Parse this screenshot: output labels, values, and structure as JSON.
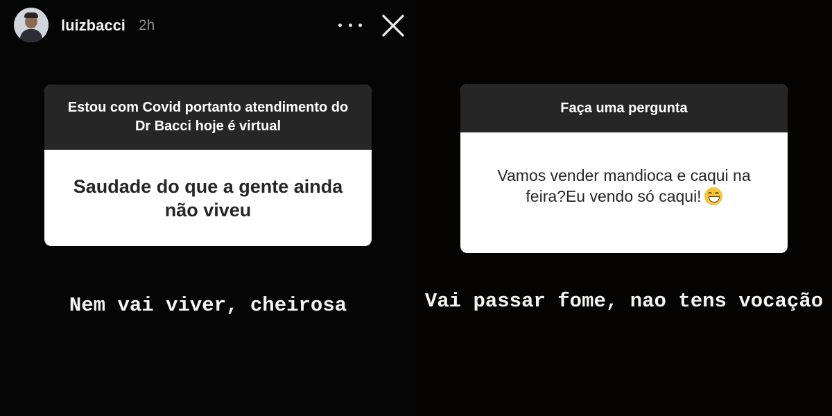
{
  "header": {
    "username": "luizbacci",
    "timestamp": "2h",
    "more_icon": "more-horizontal-icon",
    "close_icon": "close-icon"
  },
  "stories": [
    {
      "question_header": "Estou com Covid portanto atendimento do Dr Bacci hoje é virtual",
      "question": "Saudade do que a gente ainda não viveu",
      "reply": "Nem vai viver, cheirosa"
    },
    {
      "question_header": "Faça uma pergunta",
      "question": "Vamos vender mandioca e caqui na feira?Eu vendo só caqui!",
      "emoji": "grinning-face-icon",
      "reply": "Vai passar fome, nao tens vocação"
    }
  ],
  "colors": {
    "card_header_bg": "#262626",
    "card_body_bg": "#ffffff",
    "background": "#000000"
  }
}
